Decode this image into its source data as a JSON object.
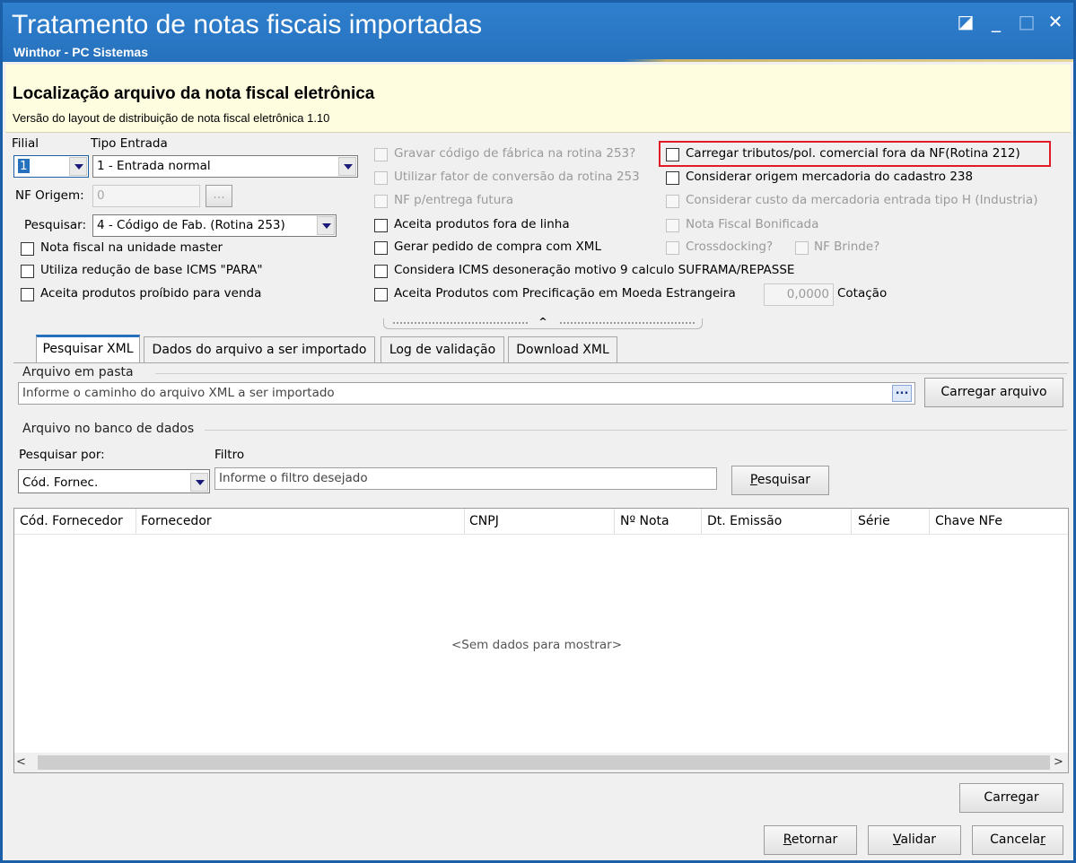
{
  "window": {
    "title": "Tratamento de notas fiscais importadas",
    "subtitle": "Winthor - PC Sistemas",
    "controls": {
      "restore": "◪",
      "minimize": "_",
      "maximize": "□",
      "close": "✕"
    }
  },
  "header": {
    "title": "Localização arquivo da nota fiscal eletrônica",
    "subtitle": "Versão do layout de distribuição de nota fiscal eletrônica 1.10"
  },
  "form": {
    "filial_label": "Filial",
    "filial_value": "1",
    "tipo_entrada_label": "Tipo Entrada",
    "tipo_entrada_value": "1 - Entrada normal",
    "nf_origem_label": "NF Origem:",
    "nf_origem_value": "0",
    "nf_origem_button": "...",
    "pesquisar_label": "Pesquisar:",
    "pesquisar_value": "4 - Código de Fab. (Rotina 253)",
    "cotacao_value": "0,0000",
    "cotacao_label": "Cotação"
  },
  "checks_col1": [
    {
      "label": "Nota fiscal na unidade master"
    },
    {
      "label": "Utiliza redução de base ICMS \"PARA\""
    },
    {
      "label": "Aceita produtos proíbido para venda"
    }
  ],
  "checks_col2": [
    {
      "label": "Gravar código de fábrica na rotina 253?"
    },
    {
      "label": "Utilizar fator de conversão da rotina 253"
    },
    {
      "label": "NF p/entrega futura"
    },
    {
      "label": "Aceita produtos fora de linha"
    },
    {
      "label": "Gerar pedido de compra com XML"
    },
    {
      "label": "Considera ICMS desoneração motivo 9 calculo SUFRAMA/REPASSE"
    },
    {
      "label": "Aceita Produtos com Precificação em Moeda Estrangeira"
    }
  ],
  "checks_col3": [
    {
      "label": "Carregar tributos/pol. comercial fora da NF(Rotina 212)"
    },
    {
      "label": "Considerar origem mercadoria do cadastro 238"
    },
    {
      "label": "Considerar custo da mercadoria entrada tipo H (Industria)"
    },
    {
      "label": "Nota Fiscal Bonificada"
    },
    {
      "label": "Crossdocking?"
    },
    {
      "label": "NF Brinde?"
    }
  ],
  "tabs": [
    {
      "label": "Pesquisar XML"
    },
    {
      "label": "Dados do arquivo a ser importado"
    },
    {
      "label": "Log de validação"
    },
    {
      "label": "Download XML"
    }
  ],
  "folder": {
    "group": "Arquivo em pasta",
    "placeholder": "Informe o caminho do arquivo XML a ser importado",
    "browse": "...",
    "load_button": "Carregar arquivo"
  },
  "db": {
    "group": "Arquivo no banco de dados",
    "search_by_label": "Pesquisar por:",
    "search_by_value": "Cód. Fornec.",
    "filter_label": "Filtro",
    "filter_placeholder": "Informe o filtro desejado",
    "search_button_first": "P",
    "search_button_rest": "esquisar"
  },
  "grid": {
    "columns": [
      "Cód. Fornecedor",
      "Fornecedor",
      "CNPJ",
      "Nº Nota",
      "Dt. Emissão",
      "Série",
      "Chave NFe"
    ],
    "empty": "<Sem dados para mostrar>",
    "scroll_left": "<",
    "scroll_right": ">"
  },
  "footer": {
    "carregar": "Carregar",
    "retornar_first": "R",
    "retornar_rest": "etornar",
    "validar_first": "V",
    "validar_rest": "alidar",
    "cancelar_main": "Cancela",
    "cancelar_last": "r"
  },
  "colors": {
    "titlebar": "#2671bd",
    "header_bg": "#fffde0",
    "highlight": "#e01b24"
  }
}
